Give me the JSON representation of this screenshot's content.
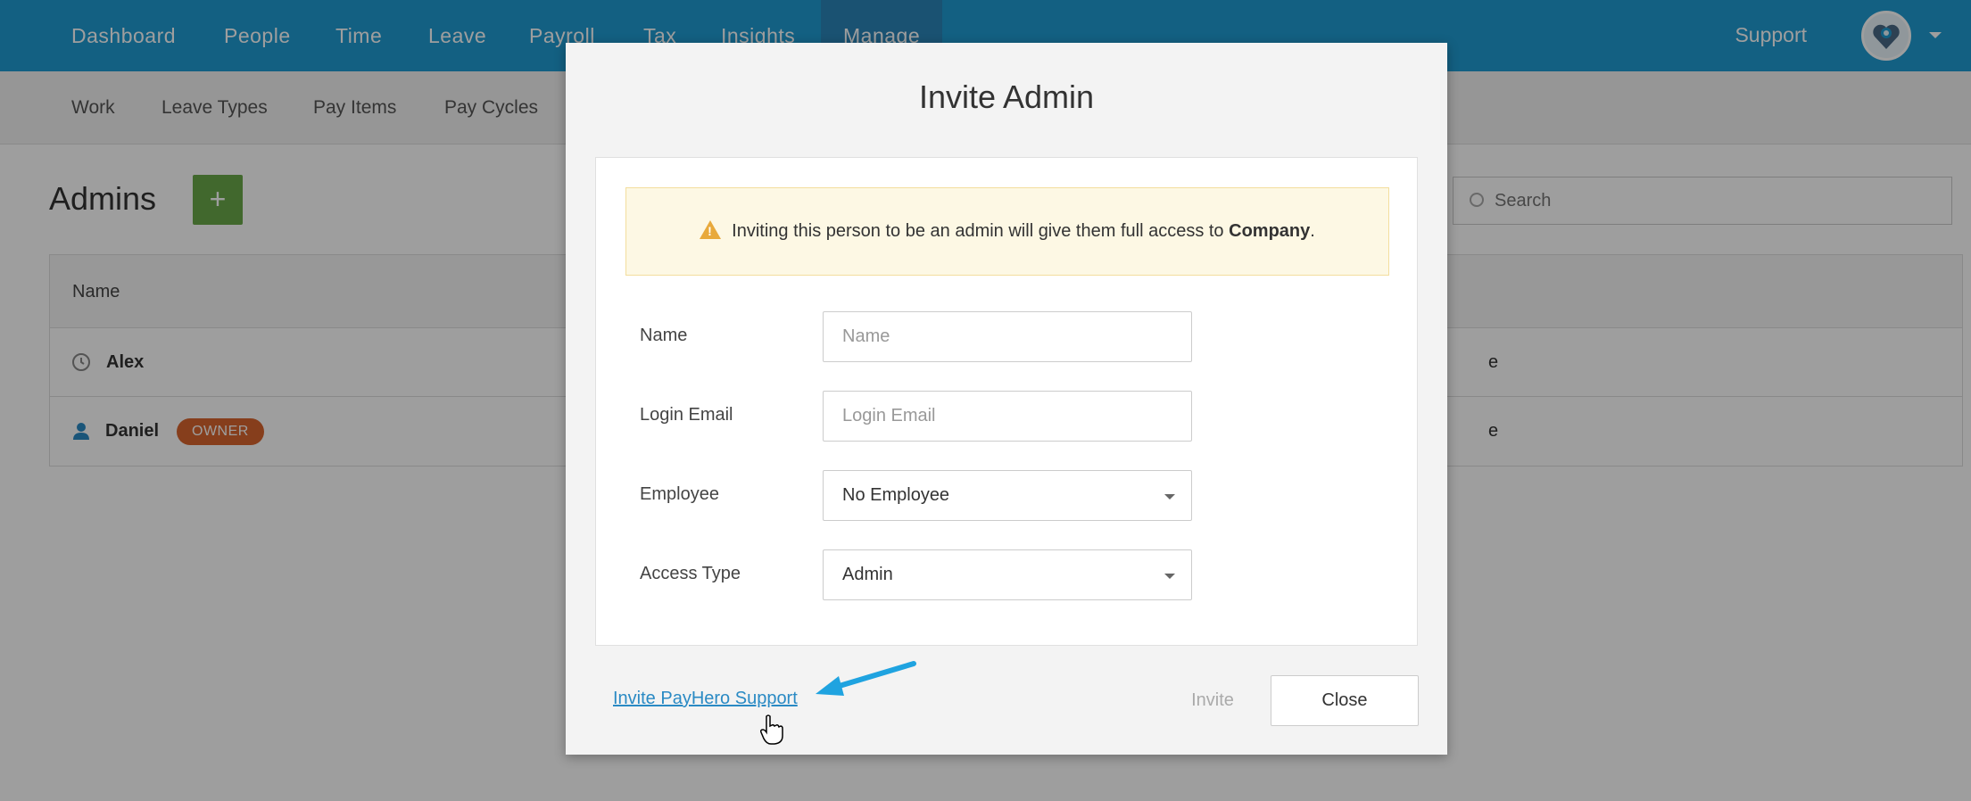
{
  "topnav": {
    "items": [
      {
        "label": "Dashboard"
      },
      {
        "label": "People"
      },
      {
        "label": "Time"
      },
      {
        "label": "Leave"
      },
      {
        "label": "Payroll"
      },
      {
        "label": "Tax"
      },
      {
        "label": "Insights"
      },
      {
        "label": "Manage",
        "active": true
      }
    ],
    "support_label": "Support",
    "avatar_icon": "user-avatar-icon"
  },
  "subnav": {
    "items": [
      {
        "label": "Work"
      },
      {
        "label": "Leave Types"
      },
      {
        "label": "Pay Items"
      },
      {
        "label": "Pay Cycles"
      }
    ]
  },
  "page": {
    "title": "Admins",
    "add_label": "+",
    "search_placeholder": "Search"
  },
  "table": {
    "header": "Name",
    "rows": [
      {
        "name": "Alex",
        "icon": "clock-icon",
        "trail": "e"
      },
      {
        "name": "Daniel",
        "icon": "person-icon",
        "badge": "OWNER",
        "trail": "e"
      }
    ]
  },
  "modal": {
    "title": "Invite Admin",
    "warning": {
      "text": "Inviting this person to be an admin will give them full access to ",
      "company": "Company",
      "suffix": "."
    },
    "fields": {
      "name_label": "Name",
      "name_placeholder": "Name",
      "email_label": "Login Email",
      "email_placeholder": "Login Email",
      "employee_label": "Employee",
      "employee_value": "No Employee",
      "access_label": "Access Type",
      "access_value": "Admin"
    },
    "support_link": "Invite PayHero Support",
    "invite_label": "Invite",
    "close_label": "Close"
  },
  "colors": {
    "nav_blue": "#1f9bd2",
    "add_green": "#6aa94a",
    "owner_orange": "#d9652e",
    "warning_bg": "#fdf8e4",
    "arrow_blue": "#1fa3e0"
  }
}
